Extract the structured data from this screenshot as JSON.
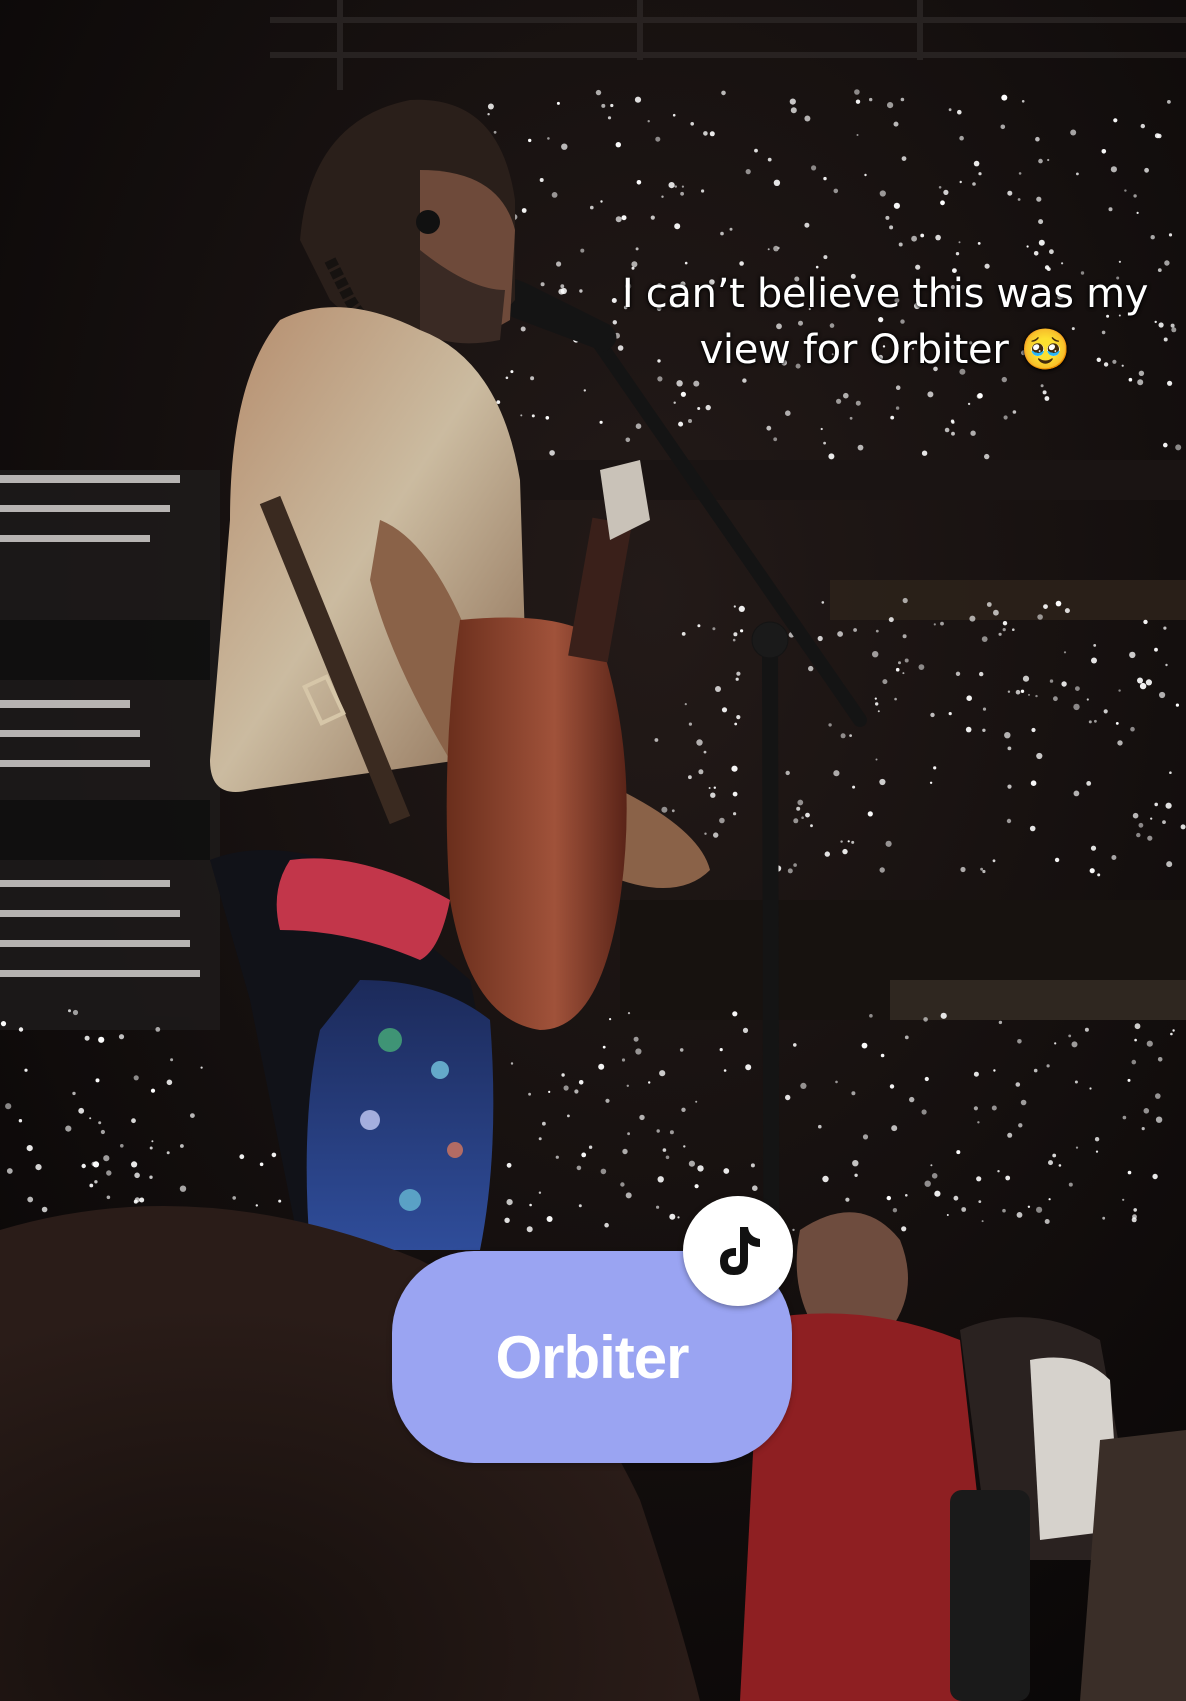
{
  "caption": {
    "line1": "I can’t believe this was my",
    "line2": "view for Orbiter",
    "emoji": "🥹"
  },
  "sticker": {
    "label": "Orbiter",
    "color": "#9aa4f2",
    "icon": "tiktok-icon"
  },
  "scene": {
    "description_icon": "concert-photo",
    "accent_colors": [
      "#c8b99a",
      "#2a3f8a",
      "#b22a2a"
    ]
  }
}
